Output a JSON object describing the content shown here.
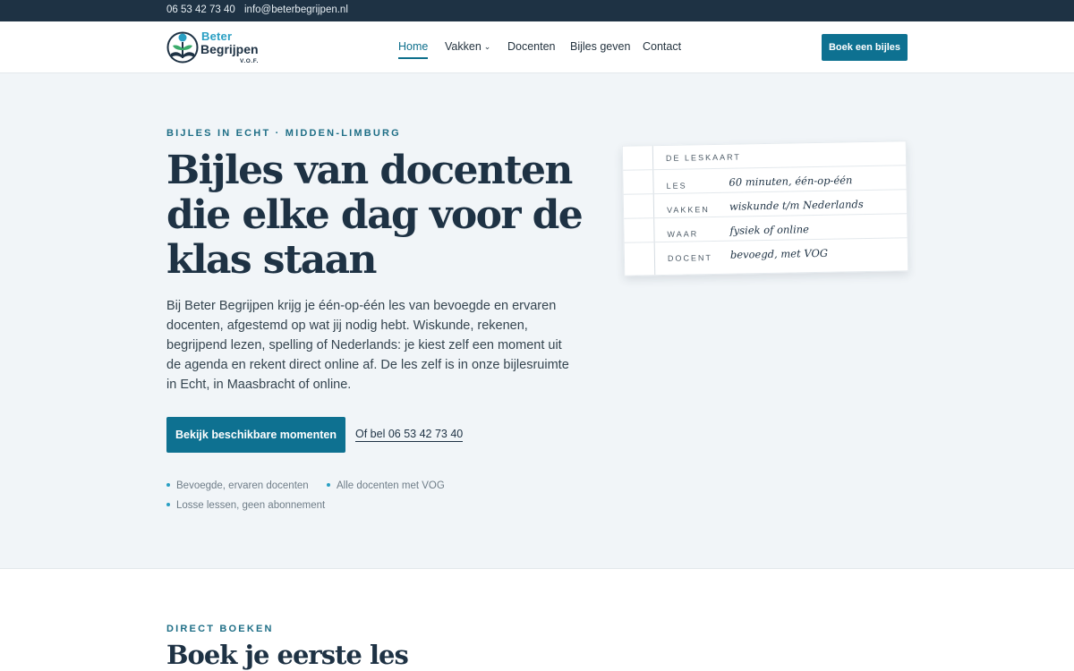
{
  "topbar": {
    "phone": "06 53 42 73 40",
    "email": "info@beterbegrijpen.nl"
  },
  "brand": {
    "line1": "Beter",
    "line2": "Begrijpen",
    "suffix": "V.O.F.",
    "logo_icon": "tree-book-logo"
  },
  "nav": {
    "items": [
      {
        "label": "Home",
        "active": true
      },
      {
        "label": "Vakken",
        "dropdown": true
      },
      {
        "label": "Docenten"
      },
      {
        "label": "Bijles geven"
      },
      {
        "label": "Contact"
      }
    ],
    "cta": "Boek een bijles"
  },
  "hero": {
    "eyebrow": "BIJLES IN ECHT · MIDDEN-LIMBURG",
    "title": "Bijles van docenten die elke dag voor de klas staan",
    "paragraph": "Bij Beter Begrijpen krijg je één-op-één les van bevoegde en ervaren docenten, afgestemd op wat jij nodig hebt. Wiskunde, rekenen, begrijpend lezen, spelling of Nederlands: je kiest zelf een moment uit de agenda en rekent direct online af. De les zelf is in onze bijlesruimte in Echt, in Maasbracht of online.",
    "primary_button": "Bekijk beschikbare momenten",
    "call_link": "Of bel 06 53 42 73 40",
    "bullets": [
      "Bevoegde, ervaren docenten",
      "Alle docenten met VOG",
      "Losse lessen, geen abonnement"
    ]
  },
  "lesson_card": {
    "title": "DE LESKAART",
    "rows": [
      {
        "label": "LES",
        "value": "60 minuten, één-op-één"
      },
      {
        "label": "VAKKEN",
        "value": "wiskunde t/m Nederlands"
      },
      {
        "label": "WAAR",
        "value": "fysiek of online"
      },
      {
        "label": "DOCENT",
        "value": "bevoegd, met VOG"
      }
    ]
  },
  "booking_section": {
    "eyebrow": "DIRECT BOEKEN",
    "title": "Boek je eerste les"
  },
  "colors": {
    "navy": "#1e3244",
    "accent": "#0e7191",
    "hero_bg": "#f1f5f8"
  }
}
